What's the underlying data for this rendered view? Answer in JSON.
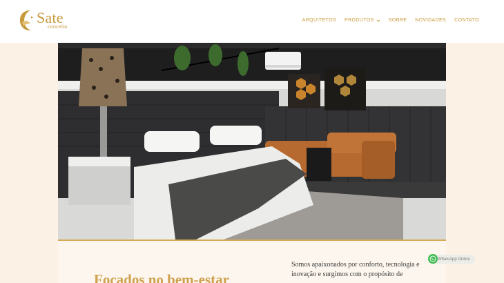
{
  "brand": {
    "name": "Sate",
    "tagline": "conceito"
  },
  "nav": {
    "items": [
      {
        "label": "ARQUITETOS"
      },
      {
        "label": "PRODUTOS",
        "has_dropdown": true
      },
      {
        "label": "SOBRE"
      },
      {
        "label": "NOVIDADES"
      },
      {
        "label": "CONTATO"
      }
    ]
  },
  "hero": {
    "image": "bedroom-showroom-photo"
  },
  "intro": {
    "headline": "Focados no bem-estar",
    "paragraph": "Somos apaixonados por conforto, tecnologia e inovação e surgimos com o propósito de"
  },
  "whatsapp": {
    "label": "WhatsApp Online"
  },
  "colors": {
    "accent": "#c89a3a",
    "background": "#fbf1e4",
    "whatsapp": "#3dba50"
  }
}
